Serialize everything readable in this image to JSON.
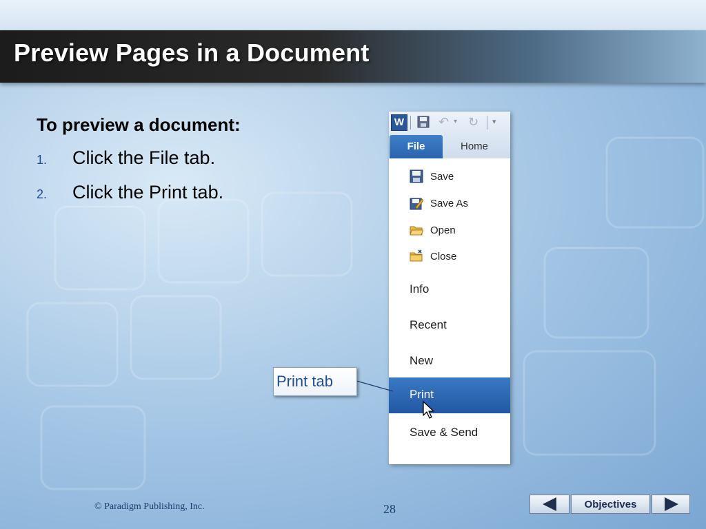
{
  "slide": {
    "title": "Preview Pages in a Document",
    "heading": "To preview a document:",
    "steps": [
      {
        "num": "1.",
        "text": "Click the File tab."
      },
      {
        "num": "2.",
        "text": "Click the Print tab."
      }
    ],
    "callout": "Print tab"
  },
  "word": {
    "app_icon": "W",
    "qat_icons": [
      "word-app-icon",
      "save-icon",
      "undo-icon",
      "redo-icon",
      "customize-qat-icon"
    ],
    "tabs": {
      "file": "File",
      "home": "Home"
    },
    "menu": {
      "save": "Save",
      "save_as": "Save As",
      "open": "Open",
      "close": "Close",
      "info": "Info",
      "recent": "Recent",
      "new": "New",
      "print": "Print",
      "save_send": "Save & Send"
    },
    "selected_item": "Print",
    "accent": "#2a63ad"
  },
  "footer": {
    "copyright": "© Paradigm Publishing, Inc.",
    "page": "28",
    "nav_label": "Objectives"
  }
}
